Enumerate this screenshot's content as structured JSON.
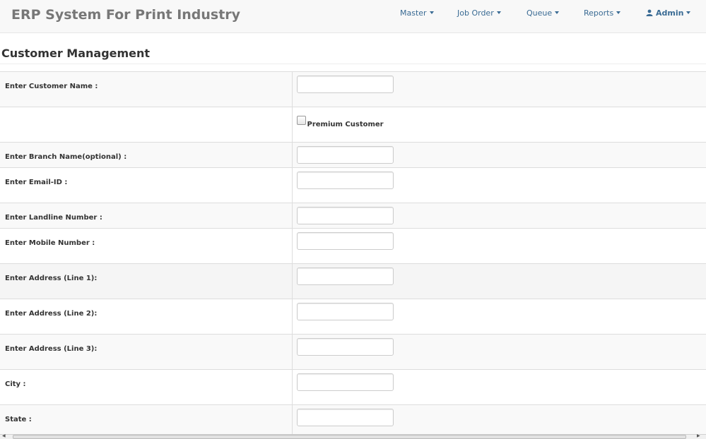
{
  "app": {
    "title": "ERP System For Print Industry"
  },
  "nav": {
    "items": [
      {
        "label": "Master"
      },
      {
        "label": "Job Order"
      },
      {
        "label": "Queue"
      },
      {
        "label": "Reports"
      }
    ],
    "user": {
      "label": "Admin",
      "icon": "user-icon"
    }
  },
  "page": {
    "title": "Customer Management"
  },
  "form": {
    "customer_name_label": "Enter Customer Name :",
    "premium_label": "Premium Customer",
    "premium_checked": false,
    "branch_label": "Enter Branch Name(optional) :",
    "email_label": "Enter Email-ID :",
    "landline_label": "Enter Landline Number :",
    "mobile_label": "Enter Mobile Number :",
    "address1_label": "Enter Address (Line 1):",
    "address2_label": "Enter Address (Line 2):",
    "address3_label": "Enter Address (Line 3):",
    "city_label": "City :",
    "state_label": "State :",
    "values": {
      "customer_name": "",
      "branch": "",
      "email": "",
      "landline": "",
      "mobile": "",
      "address1": "",
      "address2": "",
      "address3": "",
      "city": "",
      "state": ""
    }
  },
  "colors": {
    "nav_link": "#3a6b94",
    "brand": "#777777",
    "row_odd": "#f9f9f9",
    "border": "#dddddd"
  }
}
